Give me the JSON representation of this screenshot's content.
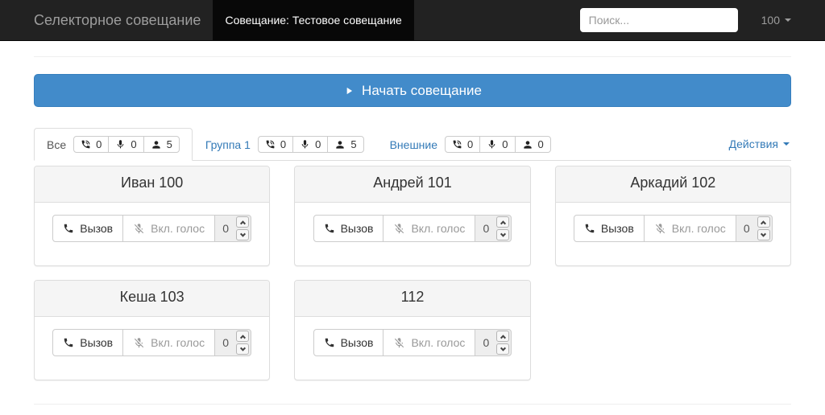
{
  "navbar": {
    "brand": "Селекторное совещание",
    "active_item": "Совещание: Тестовое совещание",
    "search_placeholder": "Поиск...",
    "user_menu_label": "100"
  },
  "start_button": {
    "label": "Начать совещание"
  },
  "tabs": [
    {
      "label": "Все",
      "active": true,
      "counters": {
        "calls": "0",
        "voice": "0",
        "members": "5"
      }
    },
    {
      "label": "Группа 1",
      "active": false,
      "counters": {
        "calls": "0",
        "voice": "0",
        "members": "5"
      }
    },
    {
      "label": "Внешние",
      "active": false,
      "counters": {
        "calls": "0",
        "voice": "0",
        "members": "0"
      }
    }
  ],
  "actions_menu": {
    "label": "Действия"
  },
  "controls": {
    "call": "Вызов",
    "voice": "Вкл. голос"
  },
  "cards": [
    {
      "title": "Иван 100",
      "count": "0"
    },
    {
      "title": "Андрей 101",
      "count": "0"
    },
    {
      "title": "Аркадий 102",
      "count": "0"
    },
    {
      "title": "Кеша 103",
      "count": "0"
    },
    {
      "title": "112",
      "count": "0"
    }
  ],
  "icons": {
    "play": "play-icon",
    "caret": "caret-down-icon",
    "call_status": "phone-waves-icon",
    "mic": "microphone-icon",
    "members": "user-icon",
    "call": "phone-icon",
    "mic_muted": "microphone-muted-icon"
  },
  "colors": {
    "navbar_bg": "#222222",
    "navbar_active_bg": "#080808",
    "primary_button": "#428bca",
    "link": "#337ab7",
    "panel_heading_bg": "#f5f5f5",
    "border": "#dddddd"
  }
}
